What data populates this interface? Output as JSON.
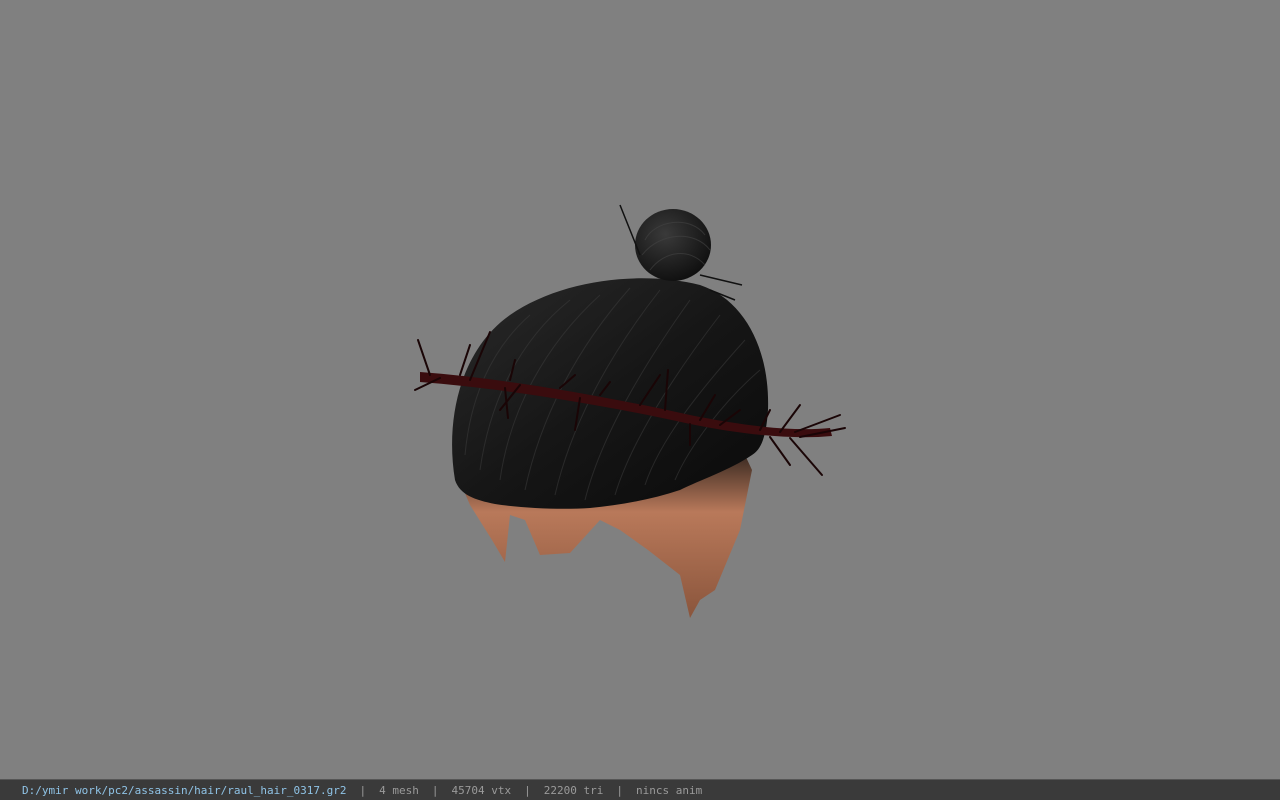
{
  "viewer": {
    "background_color": "#808080",
    "model": {
      "icon": "hair-model-icon",
      "hair_color": "#141414",
      "band_color": "#3a0c0e",
      "skin_color": "#a56a4a"
    }
  },
  "statusbar": {
    "file_path": "D:/ymir work/pc2/assassin/hair/raul_hair_0317.gr2",
    "separator": "|",
    "mesh": "4 mesh",
    "vertices": "45704 vtx",
    "triangles": "22200 tri",
    "animation": "nincs anim",
    "path_color": "#8fc3e6",
    "text_color": "#9a9a9a"
  }
}
